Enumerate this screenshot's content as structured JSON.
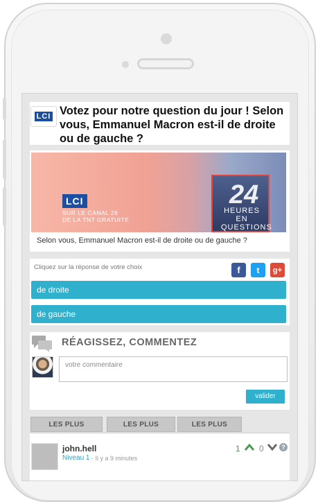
{
  "poll": {
    "logo_text": "LCI",
    "title": "Votez pour notre question du jour ! Selon vous, Emmanuel Macron est-il de droite ou de gauche ?",
    "banner": {
      "logo": "LCI",
      "subtitle_line1": "SUR LE CANAL 26",
      "subtitle_line2": "DE LA TNT GRATUITE",
      "big_number": "24",
      "heures": "HEURES",
      "en": "EN",
      "questions": "QUESTIONS"
    },
    "caption": "Selon vous, Emmanuel Macron est-il de droite ou de gauche ?",
    "hint": "Cliquez sur la réponse de votre choix",
    "choices": [
      "de droite",
      "de gauche"
    ],
    "social": {
      "facebook": "f",
      "twitter": "t",
      "googleplus": "g+"
    }
  },
  "comments": {
    "title": "RÉAGISSEZ, COMMENTEZ",
    "placeholder": "votre commentaire",
    "submit_label": "valider",
    "tabs": [
      "LES PLUS POPULAIRES",
      "LES PLUS RÉCENTS",
      "LES PLUS ANCIENS"
    ],
    "items": [
      {
        "user": "john.hell",
        "level": "Niveau 1",
        "time": "- Il y a 9 minutes",
        "upvotes": "1",
        "downvotes": "0",
        "help": "?"
      }
    ]
  },
  "colors": {
    "accent": "#2fb0cd",
    "lci_blue": "#1a4ea0",
    "up_green": "#4a9b52"
  }
}
